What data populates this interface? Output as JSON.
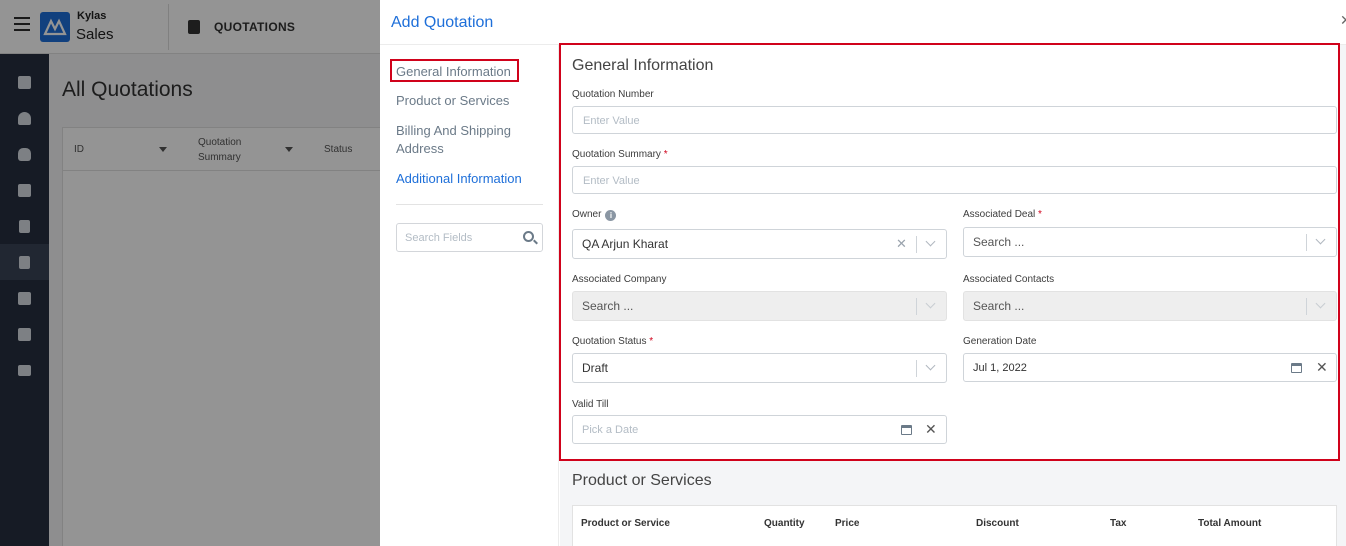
{
  "app": {
    "brand_top": "Kylas",
    "brand_bottom": "Sales",
    "module_title": "QUOTATIONS",
    "page_title": "All Quotations",
    "list_columns": [
      "ID",
      "Quotation Summary",
      "Status"
    ],
    "nav_icons": [
      "dashboard-icon",
      "user-icon",
      "money-bag-icon",
      "contacts-icon",
      "building-icon",
      "quotation-icon",
      "task-check-icon",
      "calendar-icon",
      "reports-icon"
    ],
    "accent_color": "#1e6fd9",
    "sidebar_color": "#263041"
  },
  "modal": {
    "title": "Add Quotation",
    "close_glyph": "✕",
    "left_nav": {
      "items": [
        "General Information",
        "Product or Services",
        "Billing And Shipping Address",
        "Additional Information"
      ],
      "search_placeholder": "Search Fields"
    },
    "general": {
      "section_title": "General Information",
      "quotation_number": {
        "label": "Quotation Number",
        "placeholder": "Enter Value"
      },
      "quotation_summary": {
        "label": "Quotation Summary",
        "required": "*",
        "placeholder": "Enter Value"
      },
      "owner": {
        "label": "Owner",
        "info": "i",
        "value": "QA Arjun Kharat"
      },
      "associated_deal": {
        "label": "Associated Deal",
        "required": "*",
        "placeholder": "Search ..."
      },
      "associated_company": {
        "label": "Associated Company",
        "placeholder": "Search ..."
      },
      "associated_contacts": {
        "label": "Associated Contacts",
        "placeholder": "Search ..."
      },
      "quotation_status": {
        "label": "Quotation Status",
        "required": "*",
        "value": "Draft"
      },
      "generation_date": {
        "label": "Generation Date",
        "value": "Jul 1, 2022"
      },
      "valid_till": {
        "label": "Valid Till",
        "placeholder": "Pick a Date"
      }
    },
    "products": {
      "section_title": "Product or Services",
      "columns": [
        "Product or Service",
        "Quantity",
        "Price",
        "Discount",
        "Tax",
        "Total Amount"
      ]
    },
    "highlight_color": "#d0021b"
  }
}
